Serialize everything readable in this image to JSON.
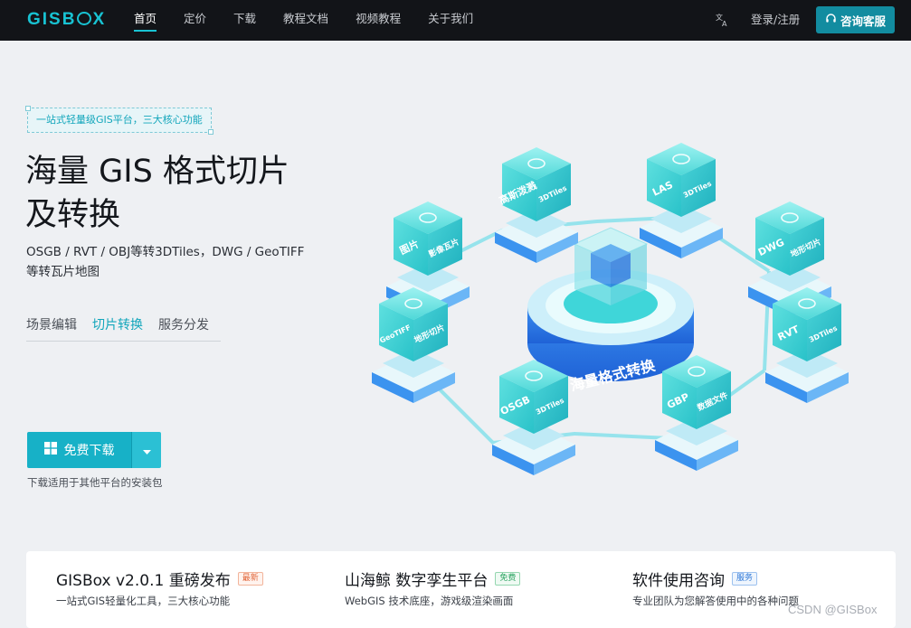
{
  "brand": {
    "logo_text": "GISBOX",
    "accent_color": "#18c3d3",
    "nav_bg": "#121418"
  },
  "nav": {
    "items": [
      {
        "label": "首页",
        "active": true
      },
      {
        "label": "定价"
      },
      {
        "label": "下载"
      },
      {
        "label": "教程文档"
      },
      {
        "label": "视频教程"
      },
      {
        "label": "关于我们"
      }
    ],
    "lang_icon": "translate-icon",
    "login_label": "登录/注册",
    "consult_label": "咨询客服",
    "consult_icon": "headset-icon"
  },
  "hero": {
    "tagline": "一站式轻量级GIS平台，三大核心功能",
    "title_line1": "海量 GIS 格式切片",
    "title_line2": "及转换",
    "subtitle_line1": "OSGB / RVT / OBJ等转3DTiles，DWG / GeoTIFF",
    "subtitle_line2": "等转瓦片地图",
    "tabs": [
      {
        "label": "场景编辑"
      },
      {
        "label": "切片转换",
        "active": true
      },
      {
        "label": "服务分发"
      }
    ],
    "download_label": "免费下载",
    "download_icon": "windows-icon",
    "dropdown_icon": "caret-down-icon",
    "download_note": "下载适用于其他平台的安装包"
  },
  "illustration": {
    "center_label": "海量格式转换",
    "cubes": [
      {
        "left": "高斯泼溅",
        "right": "3DTiles"
      },
      {
        "left": "LAS",
        "right": "3DTiles"
      },
      {
        "left": "图片",
        "right": "影像瓦片"
      },
      {
        "left": "DWG",
        "right": "地形切片"
      },
      {
        "left": "GeoTIFF",
        "right": "地形切片"
      },
      {
        "left": "RVT",
        "right": "3DTiles"
      },
      {
        "left": "OSGB",
        "right": "3DTiles"
      },
      {
        "left": "GBP",
        "right": "数据文件"
      }
    ]
  },
  "cards": [
    {
      "title": "GISBox v2.0.1 重磅发布",
      "badge": "最新",
      "badge_style": "red",
      "desc": "一站式GIS轻量化工具，三大核心功能"
    },
    {
      "title": "山海鲸 数字孪生平台",
      "badge": "免费",
      "badge_style": "green",
      "desc": "WebGIS 技术底座，游戏级渲染画面"
    },
    {
      "title": "软件使用咨询",
      "badge": "服务",
      "badge_style": "blue",
      "desc": "专业团队为您解答使用中的各种问题"
    }
  ],
  "watermark": "CSDN @GISBox"
}
